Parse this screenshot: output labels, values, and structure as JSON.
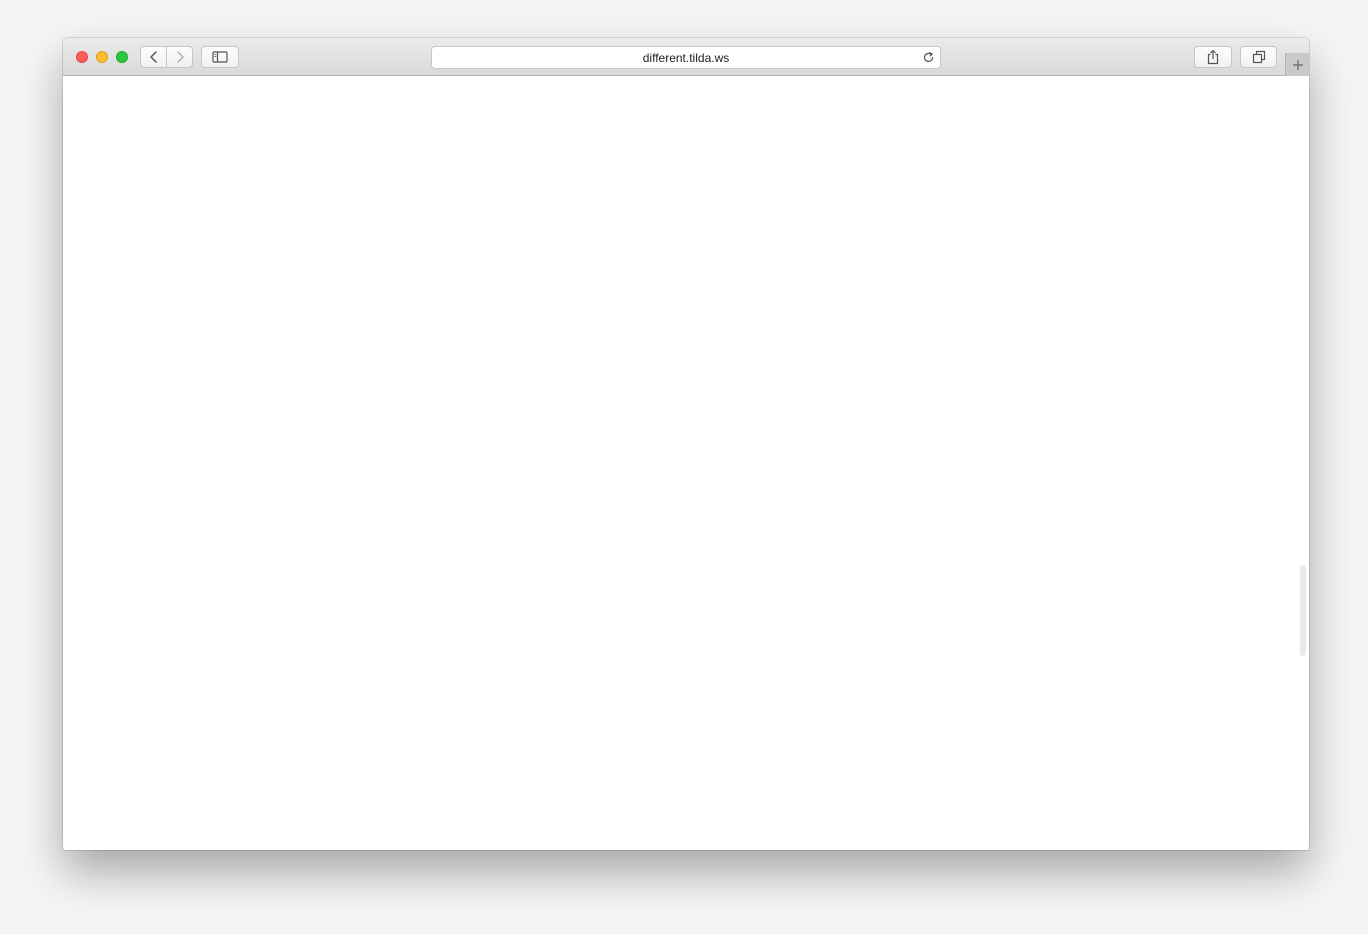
{
  "browser": {
    "url": "different.tilda.ws",
    "buttons": {
      "back": "chevron-left-icon",
      "forward": "chevron-right-icon",
      "sidebar": "sidebar-icon",
      "reload": "reload-icon",
      "share": "share-icon",
      "tabs": "tabs-overview-icon",
      "new_tab": "plus-icon"
    },
    "colors": {
      "close": "#fc5f57",
      "minimize": "#fdbc2e",
      "maximize": "#28c840",
      "page_background": "#ffffff"
    }
  },
  "page": {
    "content": ""
  }
}
